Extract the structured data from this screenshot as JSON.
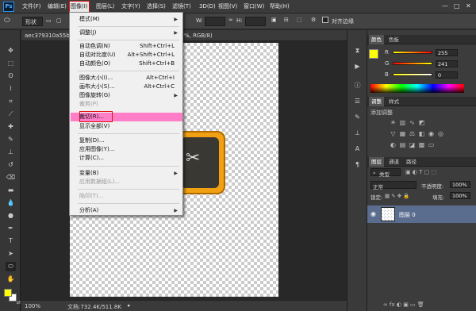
{
  "menubar": {
    "logo": "Ps",
    "items": [
      "文件(F)",
      "编辑(E)",
      "图像(I)",
      "图层(L)",
      "文字(Y)",
      "选择(S)",
      "滤镜(T)",
      "3D(D)",
      "视图(V)",
      "窗口(W)",
      "帮助(H)"
    ],
    "window_buttons": [
      "—",
      "□",
      "✕"
    ]
  },
  "options": {
    "shape_mode": "形状",
    "w_label": "W:",
    "h_label": "H:",
    "align_edges": "对齐边缘"
  },
  "document": {
    "tab_title": "aec379310a55b3",
    "tab_suffix": "%, RGB/8)",
    "zoom": "100%",
    "doc_info": "文档:732.4K/511.8K"
  },
  "image_menu": {
    "items": [
      {
        "label": "模式(M)",
        "shortcut": "",
        "submenu": true,
        "disabled": false
      },
      {
        "label": "调整(J)",
        "shortcut": "",
        "submenu": true,
        "disabled": false
      },
      {
        "label": "自动色调(N)",
        "shortcut": "Shift+Ctrl+L",
        "submenu": false,
        "disabled": false
      },
      {
        "label": "自动对比度(U)",
        "shortcut": "Alt+Shift+Ctrl+L",
        "submenu": false,
        "disabled": false
      },
      {
        "label": "自动颜色(O)",
        "shortcut": "Shift+Ctrl+B",
        "submenu": false,
        "disabled": false
      },
      {
        "label": "图像大小(I)...",
        "shortcut": "Alt+Ctrl+I",
        "submenu": false,
        "disabled": false
      },
      {
        "label": "画布大小(S)...",
        "shortcut": "Alt+Ctrl+C",
        "submenu": false,
        "disabled": false
      },
      {
        "label": "图像旋转(G)",
        "shortcut": "",
        "submenu": true,
        "disabled": false
      },
      {
        "label": "裁剪(P)",
        "shortcut": "",
        "submenu": false,
        "disabled": true
      },
      {
        "label": "裁切(R)...",
        "shortcut": "",
        "submenu": false,
        "disabled": false,
        "highlighted": true
      },
      {
        "label": "显示全部(V)",
        "shortcut": "",
        "submenu": false,
        "disabled": false
      },
      {
        "label": "复制(D)...",
        "shortcut": "",
        "submenu": false,
        "disabled": false
      },
      {
        "label": "应用图像(Y)...",
        "shortcut": "",
        "submenu": false,
        "disabled": false
      },
      {
        "label": "计算(C)...",
        "shortcut": "",
        "submenu": false,
        "disabled": false
      },
      {
        "label": "变量(B)",
        "shortcut": "",
        "submenu": true,
        "disabled": false
      },
      {
        "label": "应用数据组(L)...",
        "shortcut": "",
        "submenu": false,
        "disabled": true
      },
      {
        "label": "陷印(T)...",
        "shortcut": "",
        "submenu": false,
        "disabled": true
      },
      {
        "label": "分析(A)",
        "shortcut": "",
        "submenu": true,
        "disabled": false
      }
    ]
  },
  "color_panel": {
    "tabs": [
      "颜色",
      "色板"
    ],
    "channels": [
      {
        "label": "R",
        "value": "255"
      },
      {
        "label": "G",
        "value": "241"
      },
      {
        "label": "B",
        "value": "0"
      }
    ],
    "foreground": "#ffff00"
  },
  "adjust_panel": {
    "tabs": [
      "调整",
      "样式"
    ],
    "title": "添加调整"
  },
  "layers_panel": {
    "tabs": [
      "图层",
      "通道",
      "路径"
    ],
    "filter": "类型",
    "blend_mode": "正常",
    "opacity_label": "不透明度:",
    "opacity": "100%",
    "lock_label": "锁定:",
    "fill_label": "填充:",
    "fill": "100%",
    "layer_name": "图层 0"
  }
}
